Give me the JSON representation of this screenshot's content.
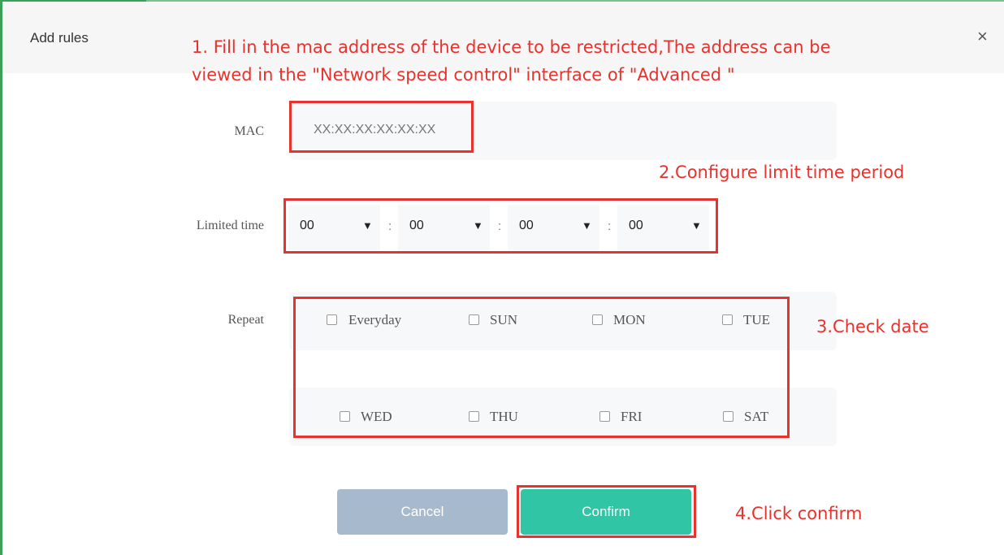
{
  "dialog": {
    "title": "Add rules",
    "close_glyph": "×"
  },
  "annotations": {
    "step1_line1": "1. Fill in the mac address of the device to be restricted,The address can be",
    "step1_line2": "viewed in the \"Network speed control\" interface of \"Advanced \"",
    "step2": "2.Configure limit time period",
    "step3": "3.Check date",
    "step4": "4.Click confirm"
  },
  "form": {
    "mac_label": "MAC",
    "mac_value": "XX:XX:XX:XX:XX:XX",
    "time_label": "Limited time",
    "time_selects": [
      "00",
      "00",
      "00",
      "00"
    ],
    "separator": ":",
    "arrow_glyph": "▼",
    "repeat_label": "Repeat",
    "days": [
      "Everyday",
      "SUN",
      "MON",
      "TUE",
      "WED",
      "THU",
      "FRI",
      "SAT"
    ]
  },
  "buttons": {
    "cancel": "Cancel",
    "confirm": "Confirm"
  },
  "colors": {
    "annotation_red": "#e8322d",
    "confirm_green": "#2fc5a5",
    "cancel_gray": "#a7b9cc",
    "window_border_green": "#3aa05a"
  }
}
